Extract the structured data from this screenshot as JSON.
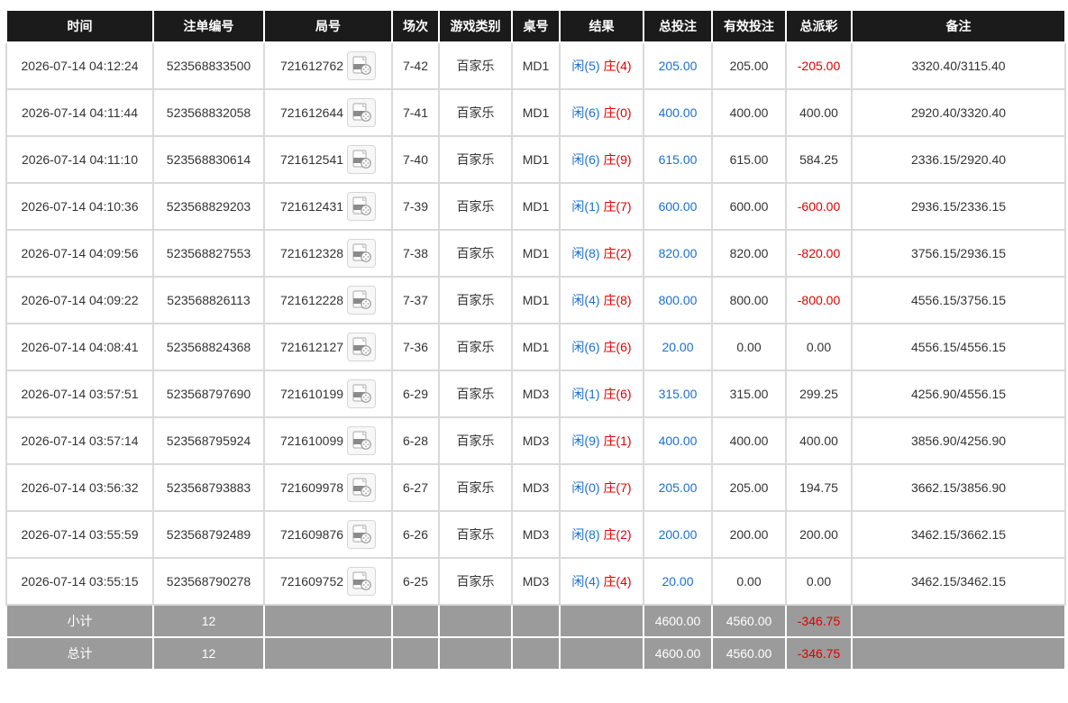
{
  "headers": [
    "时间",
    "注单编号",
    "局号",
    "场次",
    "游戏类别",
    "桌号",
    "结果",
    "总投注",
    "有效投注",
    "总派彩",
    "备注"
  ],
  "rows": [
    {
      "time": "2026-07-14 04:12:24",
      "order": "523568833500",
      "round": "721612762",
      "session": "7-42",
      "game": "百家乐",
      "table": "MD1",
      "player": "闲(5)",
      "banker": "庄(4)",
      "bet": "205.00",
      "valid": "205.00",
      "payout": "-205.00",
      "payout_negative": true,
      "note": "3320.40/3115.40"
    },
    {
      "time": "2026-07-14 04:11:44",
      "order": "523568832058",
      "round": "721612644",
      "session": "7-41",
      "game": "百家乐",
      "table": "MD1",
      "player": "闲(6)",
      "banker": "庄(0)",
      "bet": "400.00",
      "valid": "400.00",
      "payout": "400.00",
      "payout_negative": false,
      "note": "2920.40/3320.40"
    },
    {
      "time": "2026-07-14 04:11:10",
      "order": "523568830614",
      "round": "721612541",
      "session": "7-40",
      "game": "百家乐",
      "table": "MD1",
      "player": "闲(6)",
      "banker": "庄(9)",
      "bet": "615.00",
      "valid": "615.00",
      "payout": "584.25",
      "payout_negative": false,
      "note": "2336.15/2920.40"
    },
    {
      "time": "2026-07-14 04:10:36",
      "order": "523568829203",
      "round": "721612431",
      "session": "7-39",
      "game": "百家乐",
      "table": "MD1",
      "player": "闲(1)",
      "banker": "庄(7)",
      "bet": "600.00",
      "valid": "600.00",
      "payout": "-600.00",
      "payout_negative": true,
      "note": "2936.15/2336.15"
    },
    {
      "time": "2026-07-14 04:09:56",
      "order": "523568827553",
      "round": "721612328",
      "session": "7-38",
      "game": "百家乐",
      "table": "MD1",
      "player": "闲(8)",
      "banker": "庄(2)",
      "bet": "820.00",
      "valid": "820.00",
      "payout": "-820.00",
      "payout_negative": true,
      "note": "3756.15/2936.15"
    },
    {
      "time": "2026-07-14 04:09:22",
      "order": "523568826113",
      "round": "721612228",
      "session": "7-37",
      "game": "百家乐",
      "table": "MD1",
      "player": "闲(4)",
      "banker": "庄(8)",
      "bet": "800.00",
      "valid": "800.00",
      "payout": "-800.00",
      "payout_negative": true,
      "note": "4556.15/3756.15"
    },
    {
      "time": "2026-07-14 04:08:41",
      "order": "523568824368",
      "round": "721612127",
      "session": "7-36",
      "game": "百家乐",
      "table": "MD1",
      "player": "闲(6)",
      "banker": "庄(6)",
      "bet": "20.00",
      "valid": "0.00",
      "payout": "0.00",
      "payout_negative": false,
      "note": "4556.15/4556.15"
    },
    {
      "time": "2026-07-14 03:57:51",
      "order": "523568797690",
      "round": "721610199",
      "session": "6-29",
      "game": "百家乐",
      "table": "MD3",
      "player": "闲(1)",
      "banker": "庄(6)",
      "bet": "315.00",
      "valid": "315.00",
      "payout": "299.25",
      "payout_negative": false,
      "note": "4256.90/4556.15"
    },
    {
      "time": "2026-07-14 03:57:14",
      "order": "523568795924",
      "round": "721610099",
      "session": "6-28",
      "game": "百家乐",
      "table": "MD3",
      "player": "闲(9)",
      "banker": "庄(1)",
      "bet": "400.00",
      "valid": "400.00",
      "payout": "400.00",
      "payout_negative": false,
      "note": "3856.90/4256.90"
    },
    {
      "time": "2026-07-14 03:56:32",
      "order": "523568793883",
      "round": "721609978",
      "session": "6-27",
      "game": "百家乐",
      "table": "MD3",
      "player": "闲(0)",
      "banker": "庄(7)",
      "bet": "205.00",
      "valid": "205.00",
      "payout": "194.75",
      "payout_negative": false,
      "note": "3662.15/3856.90"
    },
    {
      "time": "2026-07-14 03:55:59",
      "order": "523568792489",
      "round": "721609876",
      "session": "6-26",
      "game": "百家乐",
      "table": "MD3",
      "player": "闲(8)",
      "banker": "庄(2)",
      "bet": "200.00",
      "valid": "200.00",
      "payout": "200.00",
      "payout_negative": false,
      "note": "3462.15/3662.15"
    },
    {
      "time": "2026-07-14 03:55:15",
      "order": "523568790278",
      "round": "721609752",
      "session": "6-25",
      "game": "百家乐",
      "table": "MD3",
      "player": "闲(4)",
      "banker": "庄(4)",
      "bet": "20.00",
      "valid": "0.00",
      "payout": "0.00",
      "payout_negative": false,
      "note": "3462.15/3462.15"
    }
  ],
  "footer": [
    {
      "label": "小计",
      "count": "12",
      "bet": "4600.00",
      "valid": "4560.00",
      "payout": "-346.75"
    },
    {
      "label": "总计",
      "count": "12",
      "bet": "4600.00",
      "valid": "4560.00",
      "payout": "-346.75"
    }
  ],
  "colors": {
    "header_bg": "#1b1b1b",
    "footer_bg": "#9b9b9b",
    "blue": "#1b6fd1",
    "red": "#e00000"
  },
  "icons": {
    "round_video": "video-replay-icon"
  }
}
